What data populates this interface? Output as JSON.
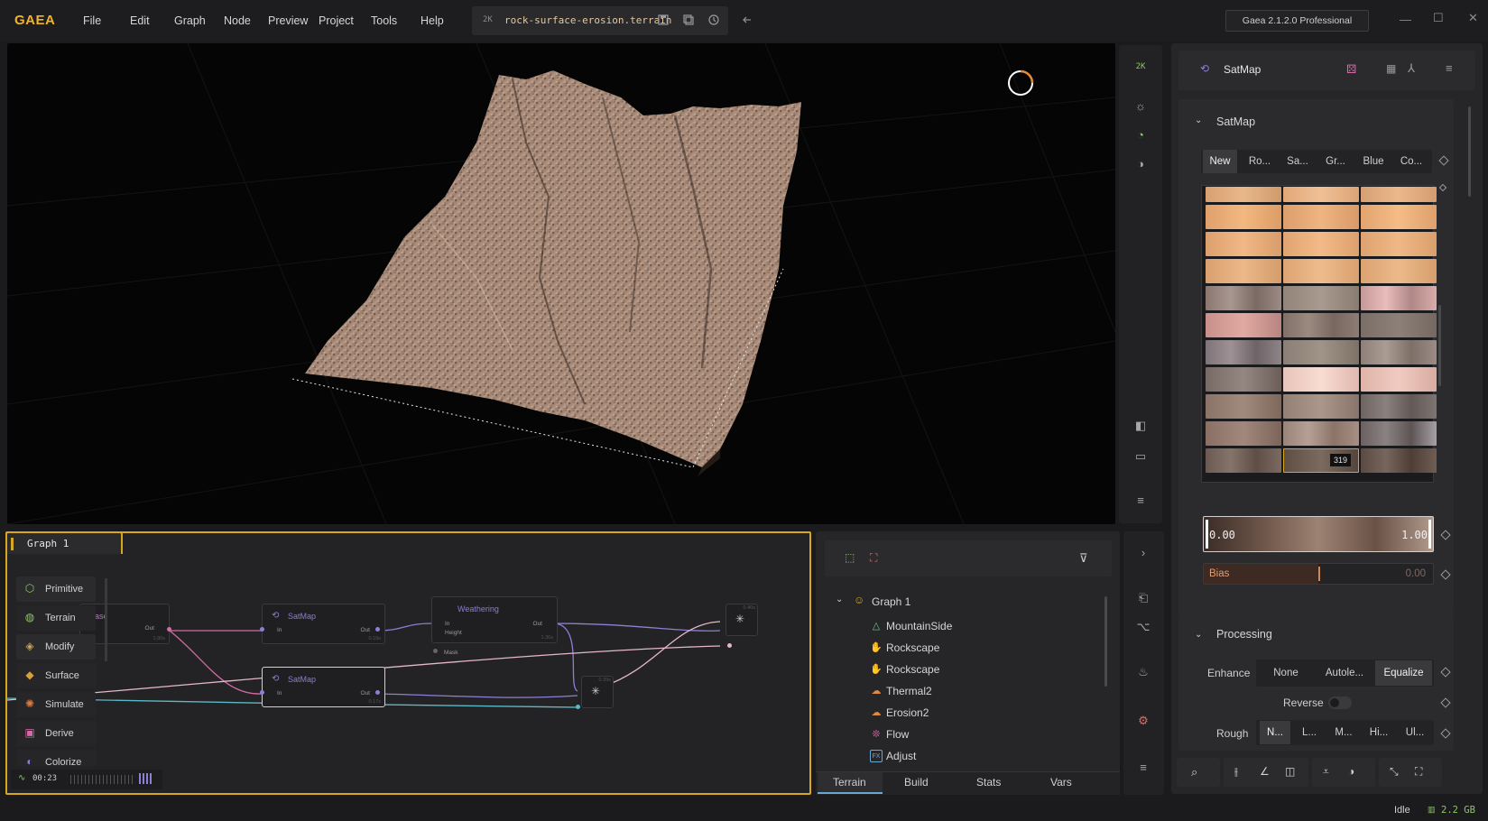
{
  "app": {
    "logo": "GAEA",
    "menu": [
      "File",
      "Edit",
      "Graph",
      "Node",
      "Preview",
      "Project",
      "Tools",
      "Help"
    ],
    "file_resolution": "2K",
    "file_name": "rock-surface-erosion.terrain",
    "version": "Gaea 2.1.2.0 Professional"
  },
  "viewport": {
    "resolution_badge": "2K"
  },
  "graph": {
    "tab_label": "Graph 1",
    "palette": [
      {
        "label": "Primitive",
        "icon": "cube-icon",
        "color": "#8dc46a"
      },
      {
        "label": "Terrain",
        "icon": "terrain-icon",
        "color": "#8dc46a"
      },
      {
        "label": "Modify",
        "icon": "modify-icon",
        "color": "#c9a35a"
      },
      {
        "label": "Surface",
        "icon": "surface-icon",
        "color": "#d6a038"
      },
      {
        "label": "Simulate",
        "icon": "simulate-icon",
        "color": "#e07a3c"
      },
      {
        "label": "Derive",
        "icon": "derive-icon",
        "color": "#d46aa8"
      },
      {
        "label": "Colorize",
        "icon": "colorize-icon",
        "color": "#8c7fd6"
      }
    ],
    "nodes": {
      "base": {
        "title": "Base",
        "out": "Out",
        "time": "1.90s"
      },
      "satmap1": {
        "title": "SatMap",
        "in": "In",
        "out": "Out",
        "time": "0.19s"
      },
      "satmap2": {
        "title": "SatMap",
        "in": "In",
        "out": "Out",
        "time": "0.17s"
      },
      "weathering": {
        "title": "Weathering",
        "in": "In",
        "height": "Height",
        "mask": "Mask",
        "out": "Out",
        "time": "1.36s"
      },
      "combine1": {
        "time": "0.39s"
      },
      "combine2": {
        "time": "0.40s"
      }
    },
    "timer": "00:23"
  },
  "outliner": {
    "root": "Graph 1",
    "items": [
      {
        "label": "MountainSide",
        "icon": "mountain-icon",
        "color": "#6ac48d"
      },
      {
        "label": "Rockscape",
        "icon": "rockscape-icon",
        "color": "#6ac48d"
      },
      {
        "label": "Rockscape",
        "icon": "rockscape-icon",
        "color": "#6ac48d"
      },
      {
        "label": "Thermal2",
        "icon": "thermal-icon",
        "color": "#e08a3c"
      },
      {
        "label": "Erosion2",
        "icon": "erosion-icon",
        "color": "#e08a3c"
      },
      {
        "label": "Flow",
        "icon": "flow-icon",
        "color": "#d46aa8"
      },
      {
        "label": "Adjust",
        "icon": "adjust-icon",
        "color": "#6aa8d4"
      }
    ],
    "tabs": [
      "Terrain",
      "Build",
      "Stats",
      "Vars"
    ]
  },
  "properties": {
    "node_name": "SatMap",
    "section": "SatMap",
    "categories": [
      "New",
      "Ro...",
      "Sa...",
      "Gr...",
      "Blue",
      "Co..."
    ],
    "selected_swatch": "319",
    "range_min": "0.00",
    "range_max": "1.00",
    "bias_label": "Bias",
    "bias_value": "0.00",
    "processing_section": "Processing",
    "enhance_label": "Enhance",
    "enhance_options": [
      "None",
      "Autole...",
      "Equalize"
    ],
    "enhance_selected": "Equalize",
    "reverse_label": "Reverse",
    "reverse_on": false,
    "rough_label": "Rough",
    "rough_options": [
      "N...",
      "L...",
      "M...",
      "Hi...",
      "Ul..."
    ]
  },
  "status": {
    "state": "Idle",
    "memory": "2.2 GB"
  },
  "colors": {
    "accent": "#d6a71f",
    "logo": "#f0b429",
    "node_title": "#8f7bd4"
  }
}
